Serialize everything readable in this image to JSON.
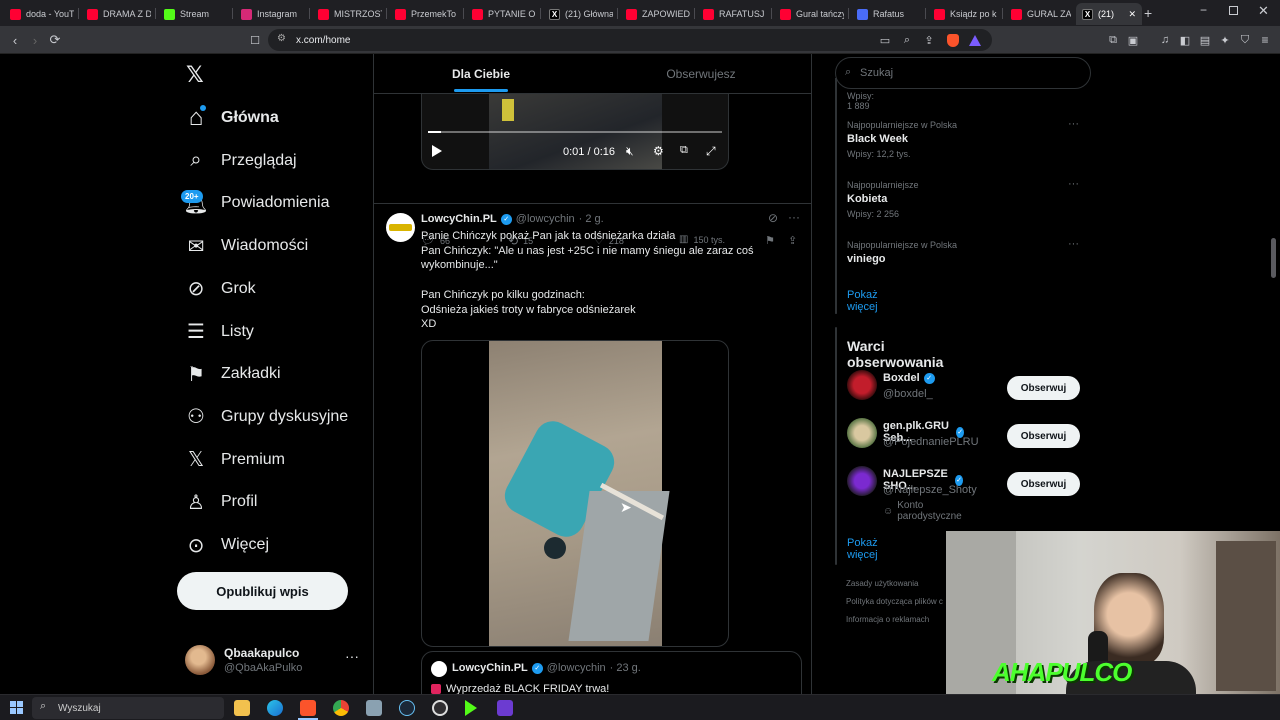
{
  "browser": {
    "tabs": [
      {
        "label": "doda - YouT",
        "fav": "#ff0033"
      },
      {
        "label": "DRAMA Z D",
        "fav": "#ff0033"
      },
      {
        "label": "Stream",
        "fav": "#53fc18"
      },
      {
        "label": "Instagram",
        "fav": "#d62976"
      },
      {
        "label": "MISTRZOST",
        "fav": "#ff0033"
      },
      {
        "label": "PrzemekTo",
        "fav": "#ff0033"
      },
      {
        "label": "PYTANIE O",
        "fav": "#ff0033"
      },
      {
        "label": "(21) Główna",
        "fav": "#000000"
      },
      {
        "label": "ZAPOWIEDŹ",
        "fav": "#ff0033"
      },
      {
        "label": "RAFATUSJ P",
        "fav": "#ff0033"
      },
      {
        "label": "Gural tańczy",
        "fav": "#ff0033"
      },
      {
        "label": "Rafatus",
        "fav": "#4a6cf7"
      },
      {
        "label": "Ksiądz po k",
        "fav": "#ff0033"
      },
      {
        "label": "GURAL ZAP",
        "fav": "#ff0033"
      },
      {
        "label": "(21)",
        "fav": "#000000"
      }
    ],
    "url": "x.com/home"
  },
  "nav": {
    "items": [
      {
        "label": "Główna",
        "icon": "home-icon"
      },
      {
        "label": "Przeglądaj",
        "icon": "search-icon"
      },
      {
        "label": "Powiadomienia",
        "icon": "bell-icon"
      },
      {
        "label": "Wiadomości",
        "icon": "mail-icon"
      },
      {
        "label": "Grok",
        "icon": "grok-icon"
      },
      {
        "label": "Listy",
        "icon": "list-icon"
      },
      {
        "label": "Zakładki",
        "icon": "bookmark-icon"
      },
      {
        "label": "Grupy dyskusyjne",
        "icon": "people-icon"
      },
      {
        "label": "Premium",
        "icon": "x-logo-icon"
      },
      {
        "label": "Profil",
        "icon": "person-icon"
      },
      {
        "label": "Więcej",
        "icon": "more-circle-icon"
      }
    ],
    "notification_badge": "20+",
    "post_button": "Opublikuj wpis",
    "account": {
      "name": "Qbaakapulco",
      "handle": "@QbaAkaPulko"
    }
  },
  "feed": {
    "tabs": [
      "Dla Ciebie",
      "Obserwujesz"
    ],
    "video1": {
      "time": "0:01 / 0:16"
    },
    "post1_actions": {
      "replies": "66",
      "reposts": "15",
      "likes": "218",
      "views": "150 tys."
    },
    "post2": {
      "name": "LowcyChin.PL",
      "handle": "@lowcychin",
      "age": "· 2 g.",
      "text_lines": [
        "Panie Chińczyk pokaż Pan jak ta odśnieżarka działa",
        "Pan Chińczyk: \"Ale u nas jest +25C i nie mamy śniegu ale zaraz coś wykombinuje...\"",
        "",
        "Pan Chińczyk po kilku godzinach:",
        "Odśnieża jakieś troty w fabryce odśnieżarek",
        "XD"
      ]
    },
    "quote": {
      "name": "LowcyChin.PL",
      "handle": "@lowcychin",
      "age": "· 23 g.",
      "text": "Wyprzedaż BLACK FRIDAY trwa!"
    }
  },
  "sidebar": {
    "search_placeholder": "Szukaj",
    "trends_top": "Wpisy: 1 889",
    "trends": [
      {
        "context": "Najpopularniejsze w Polska",
        "name": "Black Week",
        "count": "Wpisy: 12,2 tys."
      },
      {
        "context": "Najpopularniejsze",
        "name": "Kobieta",
        "count": "Wpisy: 2 256"
      },
      {
        "context": "Najpopularniejsze w Polska",
        "name": "viniego",
        "count": ""
      }
    ],
    "show_more": "Pokaż więcej",
    "follow_title": "Warci obserwowania",
    "follow": [
      {
        "name": "Boxdel",
        "handle": "@boxdel_",
        "extra": ""
      },
      {
        "name": "gen.plk.GRU Seb...",
        "handle": "@PojednaniePLRU",
        "extra": ""
      },
      {
        "name": "NAJLEPSZE SHO...",
        "handle": "@Najlepsze_Shoty",
        "extra": "Konto parodystyczne"
      }
    ],
    "follow_button": "Obserwuj",
    "footer": [
      "Zasady użytkowania",
      "Polityka dotycząca plików c",
      "Informacja o reklamach"
    ]
  },
  "overlay": {
    "logo": "AHAPULCO"
  },
  "taskbar": {
    "search": "Wyszukaj"
  }
}
